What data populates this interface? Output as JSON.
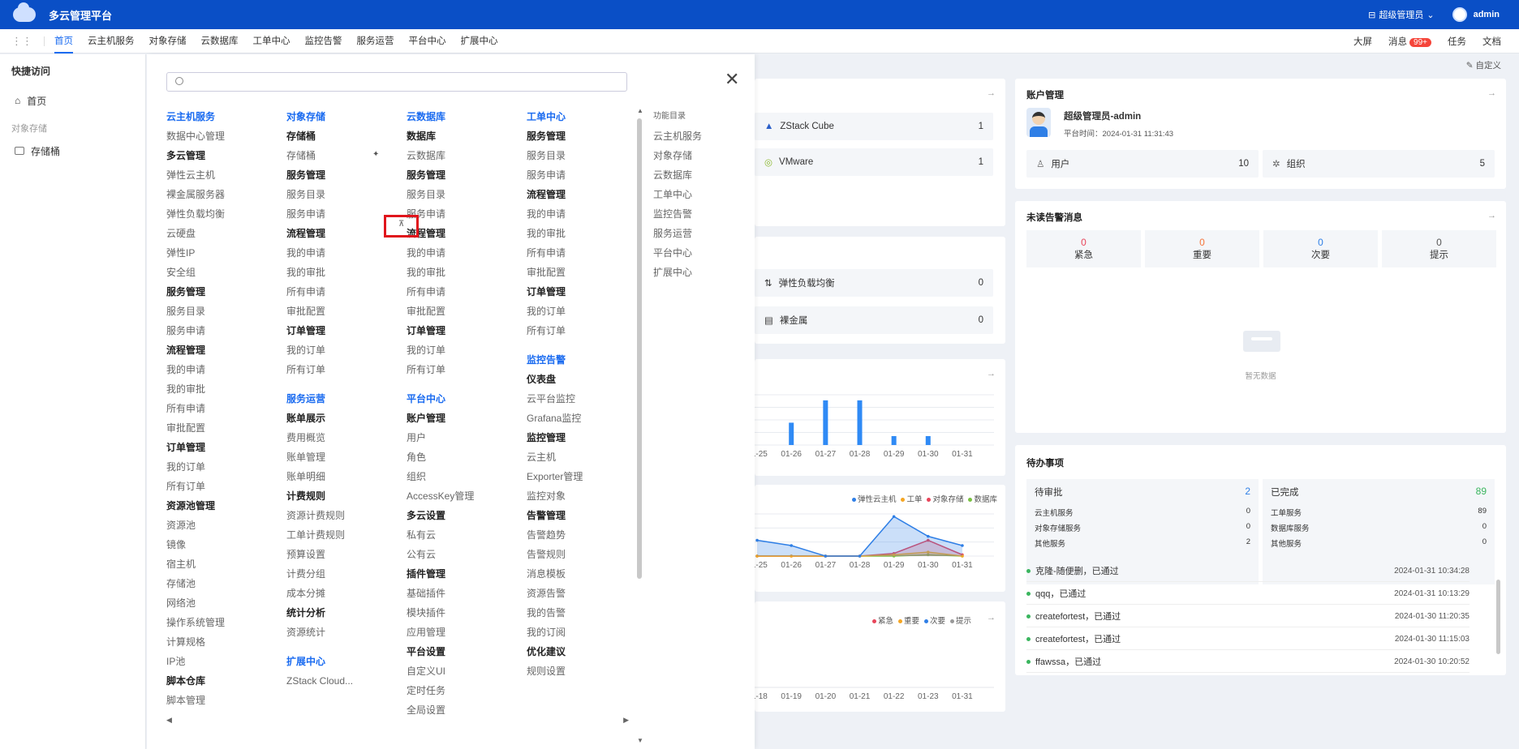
{
  "header": {
    "title": "多云管理平台",
    "role": "超级管理员",
    "user": "admin"
  },
  "nav": {
    "tabs": [
      "首页",
      "云主机服务",
      "对象存储",
      "云数据库",
      "工单中心",
      "监控告警",
      "服务运营",
      "平台中心",
      "扩展中心"
    ],
    "active": "首页",
    "right": {
      "screen": "大屏",
      "message": "消息",
      "message_badge": "99+",
      "task": "任务",
      "docs": "文档"
    }
  },
  "quick_access": {
    "title": "快捷访问",
    "home": "首页",
    "group": "对象存储",
    "bucket": "存储桶"
  },
  "menu": {
    "search_placeholder": "",
    "col1": [
      [
        "h",
        "云主机服务"
      ],
      [
        "i",
        "数据中心管理"
      ],
      [
        "b",
        "多云管理"
      ],
      [
        "i",
        "弹性云主机"
      ],
      [
        "i",
        "裸金属服务器"
      ],
      [
        "i",
        "弹性负载均衡"
      ],
      [
        "i",
        "云硬盘"
      ],
      [
        "i",
        "弹性IP"
      ],
      [
        "i",
        "安全组"
      ],
      [
        "b",
        "服务管理"
      ],
      [
        "i",
        "服务目录"
      ],
      [
        "i",
        "服务申请"
      ],
      [
        "b",
        "流程管理"
      ],
      [
        "i",
        "我的申请"
      ],
      [
        "i",
        "我的审批"
      ],
      [
        "i",
        "所有申请"
      ],
      [
        "i",
        "审批配置"
      ],
      [
        "b",
        "订单管理"
      ],
      [
        "i",
        "我的订单"
      ],
      [
        "i",
        "所有订单"
      ],
      [
        "b",
        "资源池管理"
      ],
      [
        "i",
        "资源池"
      ],
      [
        "i",
        "镜像"
      ],
      [
        "i",
        "宿主机"
      ],
      [
        "i",
        "存储池"
      ],
      [
        "i",
        "网络池"
      ],
      [
        "i",
        "操作系统管理"
      ],
      [
        "i",
        "计算规格"
      ],
      [
        "i",
        "IP池"
      ],
      [
        "b",
        "脚本仓库"
      ],
      [
        "i",
        "脚本管理"
      ]
    ],
    "col2": [
      [
        "h",
        "对象存储"
      ],
      [
        "b",
        "存储桶"
      ],
      [
        "i",
        "存储桶"
      ],
      [
        "b",
        "服务管理"
      ],
      [
        "i",
        "服务目录"
      ],
      [
        "i",
        "服务申请"
      ],
      [
        "b",
        "流程管理"
      ],
      [
        "i",
        "我的申请"
      ],
      [
        "i",
        "我的审批"
      ],
      [
        "i",
        "所有申请"
      ],
      [
        "i",
        "审批配置"
      ],
      [
        "b",
        "订单管理"
      ],
      [
        "i",
        "我的订单"
      ],
      [
        "i",
        "所有订单"
      ],
      [
        "g",
        ""
      ],
      [
        "h",
        "服务运营"
      ],
      [
        "b",
        "账单展示"
      ],
      [
        "i",
        "费用概览"
      ],
      [
        "i",
        "账单管理"
      ],
      [
        "i",
        "账单明细"
      ],
      [
        "b",
        "计费规则"
      ],
      [
        "i",
        "资源计费规则"
      ],
      [
        "i",
        "工单计费规则"
      ],
      [
        "i",
        "预算设置"
      ],
      [
        "i",
        "计费分组"
      ],
      [
        "i",
        "成本分摊"
      ],
      [
        "b",
        "统计分析"
      ],
      [
        "i",
        "资源统计"
      ],
      [
        "g",
        ""
      ],
      [
        "h",
        "扩展中心"
      ],
      [
        "i",
        "ZStack Cloud..."
      ]
    ],
    "col3": [
      [
        "h",
        "云数据库"
      ],
      [
        "b",
        "数据库"
      ],
      [
        "i",
        "云数据库"
      ],
      [
        "b",
        "服务管理"
      ],
      [
        "i",
        "服务目录"
      ],
      [
        "i",
        "服务申请"
      ],
      [
        "b",
        "流程管理"
      ],
      [
        "i",
        "我的申请"
      ],
      [
        "i",
        "我的审批"
      ],
      [
        "i",
        "所有申请"
      ],
      [
        "i",
        "审批配置"
      ],
      [
        "b",
        "订单管理"
      ],
      [
        "i",
        "我的订单"
      ],
      [
        "i",
        "所有订单"
      ],
      [
        "g",
        ""
      ],
      [
        "h",
        "平台中心"
      ],
      [
        "b",
        "账户管理"
      ],
      [
        "i",
        "用户"
      ],
      [
        "i",
        "角色"
      ],
      [
        "i",
        "组织"
      ],
      [
        "i",
        "AccessKey管理"
      ],
      [
        "b",
        "多云设置"
      ],
      [
        "i",
        "私有云"
      ],
      [
        "i",
        "公有云"
      ],
      [
        "b",
        "插件管理"
      ],
      [
        "i",
        "基础插件"
      ],
      [
        "i",
        "模块插件"
      ],
      [
        "i",
        "应用管理"
      ],
      [
        "b",
        "平台设置"
      ],
      [
        "i",
        "自定义UI"
      ],
      [
        "i",
        "定时任务"
      ],
      [
        "i",
        "全局设置"
      ]
    ],
    "col4": [
      [
        "h",
        "工单中心"
      ],
      [
        "b",
        "服务管理"
      ],
      [
        "i",
        "服务目录"
      ],
      [
        "i",
        "服务申请"
      ],
      [
        "b",
        "流程管理"
      ],
      [
        "i",
        "我的申请"
      ],
      [
        "i",
        "我的审批"
      ],
      [
        "i",
        "所有申请"
      ],
      [
        "i",
        "审批配置"
      ],
      [
        "b",
        "订单管理"
      ],
      [
        "i",
        "我的订单"
      ],
      [
        "i",
        "所有订单"
      ],
      [
        "g",
        ""
      ],
      [
        "h",
        "监控告警"
      ],
      [
        "b",
        "仪表盘"
      ],
      [
        "i",
        "云平台监控"
      ],
      [
        "i",
        "Grafana监控"
      ],
      [
        "b",
        "监控管理"
      ],
      [
        "i",
        "云主机"
      ],
      [
        "i",
        "Exporter管理"
      ],
      [
        "i",
        "监控对象"
      ],
      [
        "b",
        "告警管理"
      ],
      [
        "i",
        "告警趋势"
      ],
      [
        "i",
        "告警规则"
      ],
      [
        "i",
        "消息模板"
      ],
      [
        "i",
        "资源告警"
      ],
      [
        "i",
        "我的告警"
      ],
      [
        "i",
        "我的订阅"
      ],
      [
        "b",
        "优化建议"
      ],
      [
        "i",
        "规则设置"
      ]
    ],
    "catalog_title": "功能目录",
    "catalog": [
      "云主机服务",
      "对象存储",
      "云数据库",
      "工单中心",
      "监控告警",
      "服务运营",
      "平台中心",
      "扩展中心"
    ]
  },
  "dashboard": {
    "customize": "自定义",
    "platforms": [
      {
        "name": "ZStack Cube",
        "value": "1"
      },
      {
        "name": "VMware",
        "value": "1"
      }
    ],
    "resources": [
      {
        "name": "弹性负载均衡",
        "value": "0"
      },
      {
        "name": "裸金属",
        "value": "0"
      }
    ],
    "bar_chart": {
      "type": "bar",
      "categories": [
        "01-25",
        "01-26",
        "01-27",
        "01-28",
        "01-29",
        "01-30",
        "01-31"
      ],
      "values": [
        0,
        2,
        4,
        4,
        0.8,
        0.8,
        0
      ]
    },
    "line_chart": {
      "type": "area",
      "categories": [
        "01-25",
        "01-26",
        "01-27",
        "01-28",
        "01-29",
        "01-30",
        "01-31"
      ],
      "series": [
        {
          "name": "弹性云主机",
          "color": "#2f7fe6",
          "values": [
            1.2,
            0.8,
            0,
            0,
            3,
            1.5,
            0.8
          ]
        },
        {
          "name": "工单",
          "color": "#f5a623",
          "values": [
            0,
            0,
            0,
            0,
            0.1,
            0.3,
            0
          ]
        },
        {
          "name": "对象存储",
          "color": "#e8455a",
          "values": [
            0,
            0,
            0,
            0,
            0.2,
            1.2,
            0.1
          ]
        },
        {
          "name": "数据库",
          "color": "#7ac142",
          "values": [
            0,
            0,
            0,
            0,
            0,
            0.1,
            0
          ]
        }
      ]
    },
    "alarm_chart": {
      "legend": [
        {
          "name": "紧急",
          "color": "#e8455a"
        },
        {
          "name": "重要",
          "color": "#f5a623"
        },
        {
          "name": "次要",
          "color": "#2f7fe6"
        },
        {
          "name": "提示",
          "color": "#999999"
        }
      ],
      "categories": [
        "01-18",
        "01-19",
        "01-20",
        "01-21",
        "01-22",
        "01-23",
        "01-31"
      ]
    },
    "account": {
      "title": "账户管理",
      "name": "超级管理员-admin",
      "time": "平台时间：2024-01-31 11:31:43",
      "users_label": "用户",
      "users": "10",
      "org_label": "组织",
      "orgs": "5"
    },
    "alerts": {
      "title": "未读告警消息",
      "items": [
        {
          "label": "紧急",
          "value": "0",
          "color": "#e8455a"
        },
        {
          "label": "重要",
          "value": "0",
          "color": "#f5743a"
        },
        {
          "label": "次要",
          "value": "0",
          "color": "#2f7fe6"
        },
        {
          "label": "提示",
          "value": "0",
          "color": "#555555"
        }
      ],
      "empty": "暂无数据"
    },
    "todo": {
      "title": "待办事项",
      "pending_label": "待审批",
      "pending": "2",
      "done_label": "已完成",
      "done": "89",
      "pending_rows": [
        [
          "云主机服务",
          "0"
        ],
        [
          "对象存储服务",
          "0"
        ],
        [
          "其他服务",
          "2"
        ]
      ],
      "done_rows": [
        [
          "工单服务",
          "89"
        ],
        [
          "数据库服务",
          "0"
        ],
        [
          "其他服务",
          "0"
        ]
      ],
      "records": [
        {
          "text": "克隆-随便删，已通过",
          "time": "2024-01-31 10:34:28"
        },
        {
          "text": "qqq，已通过",
          "time": "2024-01-31 10:13:29"
        },
        {
          "text": "createfortest，已通过",
          "time": "2024-01-30 11:20:35"
        },
        {
          "text": "createfortest，已通过",
          "time": "2024-01-30 11:15:03"
        },
        {
          "text": "ffawssa，已通过",
          "time": "2024-01-30 10:20:52"
        }
      ]
    }
  }
}
